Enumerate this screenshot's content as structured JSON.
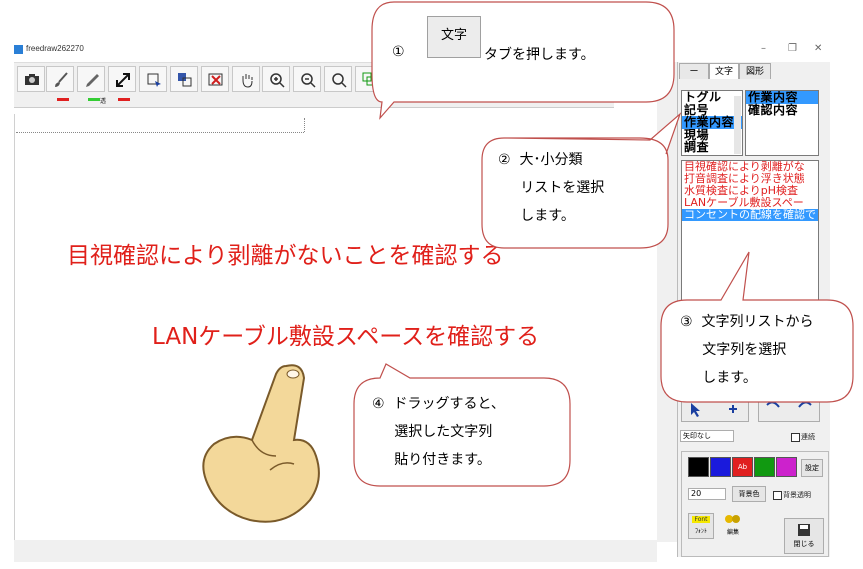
{
  "window": {
    "title": "freedraw262270",
    "minimize": "–",
    "maximize": "❐",
    "close": "✕"
  },
  "toolbar": {
    "tools": [
      "camera-icon",
      "brush-icon",
      "pen-icon",
      "arrow-icon",
      "select-icon",
      "copy-icon",
      "delete-icon",
      "hand-icon",
      "zoom-in-icon",
      "zoom-out-icon",
      "zoom-reset-icon",
      "layers-icon"
    ],
    "marker_label": "透",
    "colors": {
      "red": "#e02020",
      "green": "#33cc33"
    }
  },
  "canvas": {
    "line1": "目視確認により剥離がないことを確認する",
    "line2": "LANケーブル敷設スペースを確認する"
  },
  "panel": {
    "tabs": [
      "ー",
      "文字",
      "図形"
    ],
    "category_list": [
      {
        "label": "トグル",
        "selected": false
      },
      {
        "label": "記号",
        "selected": false
      },
      {
        "label": "作業内容",
        "selected": true
      },
      {
        "label": "現場",
        "selected": false
      },
      {
        "label": "調査",
        "selected": false
      }
    ],
    "subcategory_list": [
      {
        "label": "作業内容",
        "selected": true
      },
      {
        "label": "確認内容",
        "selected": false
      }
    ],
    "string_list": [
      {
        "label": "目視確認により剥離がな",
        "selected": false
      },
      {
        "label": "打音調査により浮き状態",
        "selected": false
      },
      {
        "label": "水質検査によりpH検査",
        "selected": false
      },
      {
        "label": "LANケーブル敷設スペー",
        "selected": false
      },
      {
        "label": "コンセントの配線を確認で",
        "selected": true
      }
    ],
    "arrow_select": "矢印なし",
    "continuous_label": "連続",
    "color_swatches": [
      "#000000",
      "#1a1adc",
      "#e02020",
      "#119911",
      "#cc22cc"
    ],
    "swatch_label": "Ab",
    "settings_button": "設定",
    "font_size": "20",
    "bg_color_button": "背景色",
    "bg_transparent_label": "背景透明",
    "font_button": "ﾌｫﾝﾄ",
    "font_icon_label": "Font",
    "edit_button": "編集",
    "close_button": "閉じる"
  },
  "callouts": {
    "c1_num": "①",
    "c1_button": "文字",
    "c1_text": "タブを押します。",
    "c2_text": "②  大･小分類\n     リストを選択\n     します。",
    "c3_text": "③  文字列リストから\n     文字列を選択\n     します。",
    "c4_text": "④  ドラッグすると、\n     選択した文字列\n     貼り付きます。"
  }
}
